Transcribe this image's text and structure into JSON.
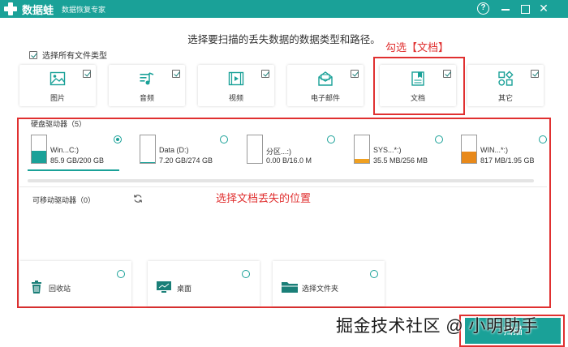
{
  "app": {
    "name": "数据蛙",
    "subtitle": "数据恢复专家",
    "help_label": "?",
    "close_label": "✕"
  },
  "heading": "选择要扫描的丢失数据的数据类型和路径。",
  "select_all_label": "选择所有文件类型",
  "file_types": [
    {
      "label": "图片",
      "icon": "image-icon",
      "checked": true
    },
    {
      "label": "音频",
      "icon": "music-icon",
      "checked": true
    },
    {
      "label": "视频",
      "icon": "video-icon",
      "checked": true
    },
    {
      "label": "电子邮件",
      "icon": "mail-icon",
      "checked": true
    },
    {
      "label": "文档",
      "icon": "document-icon",
      "checked": true
    },
    {
      "label": "其它",
      "icon": "other-icon",
      "checked": true
    }
  ],
  "annotations": {
    "check_docs": "勾选【文档】",
    "choose_location": "选择文档丢失的位置"
  },
  "hard_drives": {
    "title": "硬盘驱动器（5）",
    "drives": [
      {
        "name": "Win...C:)",
        "size": "85.9 GB/200 GB",
        "used": 0.43,
        "color": "#1aa198",
        "selected": true
      },
      {
        "name": "Data (D:)",
        "size": "7.20 GB/274 GB",
        "used": 0.03,
        "color": "#1aa198",
        "selected": false
      },
      {
        "name": "分区...:)",
        "size": "0.00  B/16.0 M",
        "used": 0.0,
        "color": "#1aa198",
        "selected": false
      },
      {
        "name": "SYS...*:)",
        "size": "35.5 MB/256 MB",
        "used": 0.14,
        "color": "#f0a020",
        "selected": false
      },
      {
        "name": "WIN...*:)",
        "size": "817 MB/1.95 GB",
        "used": 0.42,
        "color": "#e8891a",
        "selected": false
      }
    ]
  },
  "removable": {
    "title": "可移动驱动器（0）"
  },
  "locations": [
    {
      "label": "回收站",
      "icon": "recycle-bin-icon"
    },
    {
      "label": "桌面",
      "icon": "desktop-icon"
    },
    {
      "label": "选择文件夹",
      "icon": "folder-icon"
    }
  ],
  "scan_button": "扫描",
  "watermark": "掘金技术社区 @ 小明助手",
  "colors": {
    "accent": "#1aa198",
    "annotation": "#e03030"
  }
}
